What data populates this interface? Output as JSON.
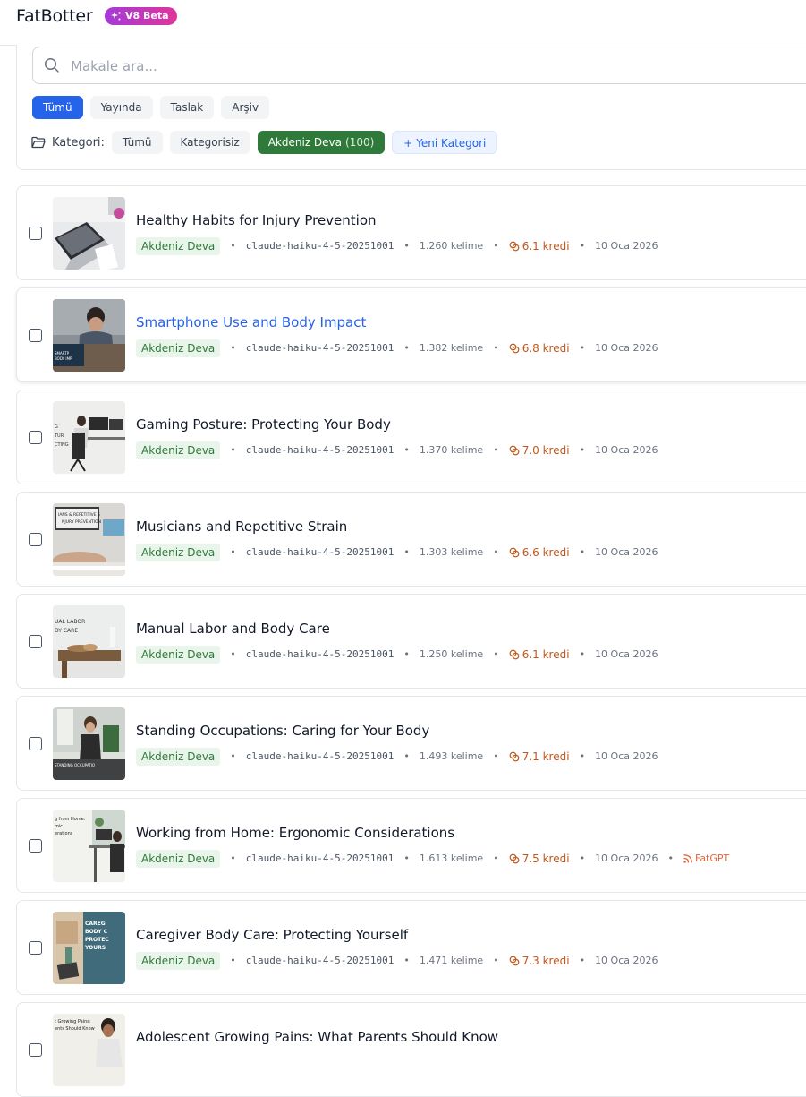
{
  "header": {
    "brand": "FatBotter",
    "badge": "V8 Beta"
  },
  "search": {
    "placeholder": "Makale ara..."
  },
  "status_tabs": [
    "Tümü",
    "Yayında",
    "Taslak",
    "Arşiv"
  ],
  "category_filter": {
    "label": "Kategori:",
    "all": "Tümü",
    "uncategorized": "Kategorisiz",
    "active_name": "Akdeniz Deva",
    "active_count": "(100)",
    "new_label": "Yeni Kategori"
  },
  "colors": {
    "primary": "#2563eb",
    "category_green": "#2f7a3a",
    "credit_orange": "#c2571a",
    "beta_start": "#a43ad9",
    "beta_end": "#e0359a"
  },
  "articles": [
    {
      "title": "Healthy Habits for Injury Prevention",
      "category": "Akdeniz Deva",
      "model": "claude-haiku-4-5-20251001",
      "words": "1.260 kelime",
      "credits": "6.1 kredi",
      "date": "10 Oca 2026",
      "source": ""
    },
    {
      "title": "Smartphone Use and Body Impact",
      "category": "Akdeniz Deva",
      "model": "claude-haiku-4-5-20251001",
      "words": "1.382 kelime",
      "credits": "6.8 kredi",
      "date": "10 Oca 2026",
      "source": ""
    },
    {
      "title": "Gaming Posture: Protecting Your Body",
      "category": "Akdeniz Deva",
      "model": "claude-haiku-4-5-20251001",
      "words": "1.370 kelime",
      "credits": "7.0 kredi",
      "date": "10 Oca 2026",
      "source": ""
    },
    {
      "title": "Musicians and Repetitive Strain",
      "category": "Akdeniz Deva",
      "model": "claude-haiku-4-5-20251001",
      "words": "1.303 kelime",
      "credits": "6.6 kredi",
      "date": "10 Oca 2026",
      "source": ""
    },
    {
      "title": "Manual Labor and Body Care",
      "category": "Akdeniz Deva",
      "model": "claude-haiku-4-5-20251001",
      "words": "1.250 kelime",
      "credits": "6.1 kredi",
      "date": "10 Oca 2026",
      "source": ""
    },
    {
      "title": "Standing Occupations: Caring for Your Body",
      "category": "Akdeniz Deva",
      "model": "claude-haiku-4-5-20251001",
      "words": "1.493 kelime",
      "credits": "7.1 kredi",
      "date": "10 Oca 2026",
      "source": ""
    },
    {
      "title": "Working from Home: Ergonomic Considerations",
      "category": "Akdeniz Deva",
      "model": "claude-haiku-4-5-20251001",
      "words": "1.613 kelime",
      "credits": "7.5 kredi",
      "date": "10 Oca 2026",
      "source": "FatGPT"
    },
    {
      "title": "Caregiver Body Care: Protecting Yourself",
      "category": "Akdeniz Deva",
      "model": "claude-haiku-4-5-20251001",
      "words": "1.471 kelime",
      "credits": "7.3 kredi",
      "date": "10 Oca 2026",
      "source": ""
    },
    {
      "title": "Adolescent Growing Pains: What Parents Should Know",
      "category": "",
      "model": "",
      "words": "",
      "credits": "",
      "date": "",
      "source": ""
    }
  ]
}
